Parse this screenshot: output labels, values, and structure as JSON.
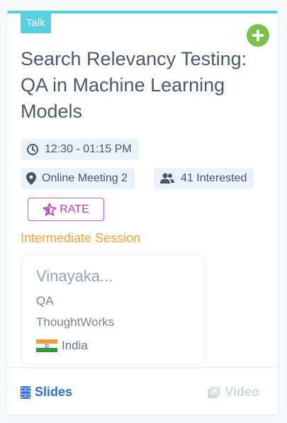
{
  "session": {
    "type_tag": "Talk",
    "title": "Search Relevancy Testing: QA in Machine Learning Models",
    "time": "12:30 - 01:15 PM",
    "location": "Online Meeting 2",
    "interested": "41 Interested",
    "rate_label": "RATE",
    "level": "Intermediate Session"
  },
  "speaker": {
    "name": "Vinayaka...",
    "role": "QA",
    "company": "ThoughtWorks",
    "country": "India"
  },
  "footer": {
    "slides_label": "Slides",
    "video_label": "Video"
  },
  "colors": {
    "accent": "#55d0e0",
    "add": "#7bc24c",
    "rate": "#b63db9",
    "level": "#f2a43a",
    "slides": "#2e6fd8",
    "disabled": "#d3d7db"
  },
  "icons": [
    "plus-icon",
    "clock-icon",
    "location-pin-icon",
    "people-icon",
    "star-icon",
    "film-icon",
    "video-icon",
    "india-flag-icon"
  ]
}
